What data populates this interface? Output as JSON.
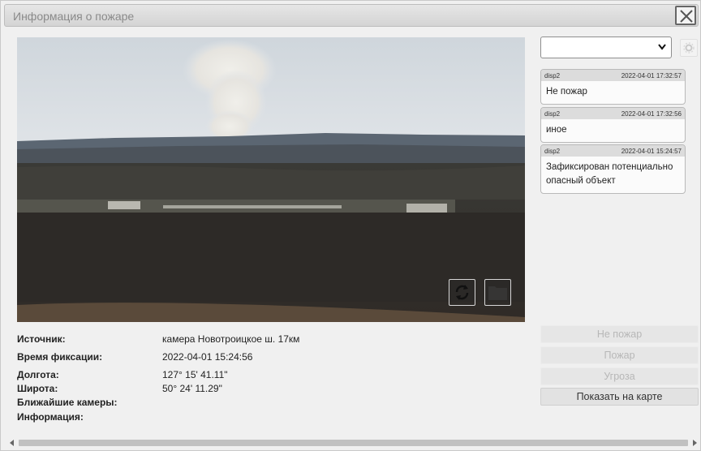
{
  "dialog": {
    "title": "Информация о пожаре"
  },
  "camera_view": {
    "refresh_icon": "refresh-icon",
    "folder_icon": "folder-icon"
  },
  "info": {
    "source_label": "Источник:",
    "source_value": "камера Новотроицкое ш. 17км",
    "time_label": "Время фиксации:",
    "time_value": "2022-04-01 15:24:56",
    "lon_label": "Долгота:",
    "lon_value": "127° 15' 41.11\"",
    "lat_label": "Широта:",
    "lat_value": "50° 24' 11.29\"",
    "cameras_label": "Ближайшие камеры:",
    "information_label": "Информация:"
  },
  "status_select": {
    "value": ""
  },
  "comments": [
    {
      "user": "disp2",
      "time": "2022-04-01 17:32:57",
      "text": "Не пожар"
    },
    {
      "user": "disp2",
      "time": "2022-04-01 17:32:56",
      "text": "иное"
    },
    {
      "user": "disp2",
      "time": "2022-04-01 15:24:57",
      "text": "Зафиксирован потенциально опасный объект"
    }
  ],
  "actions": {
    "not_fire": "Не пожар",
    "fire": "Пожар",
    "threat": "Угроза",
    "show_on_map": "Показать на карте"
  }
}
